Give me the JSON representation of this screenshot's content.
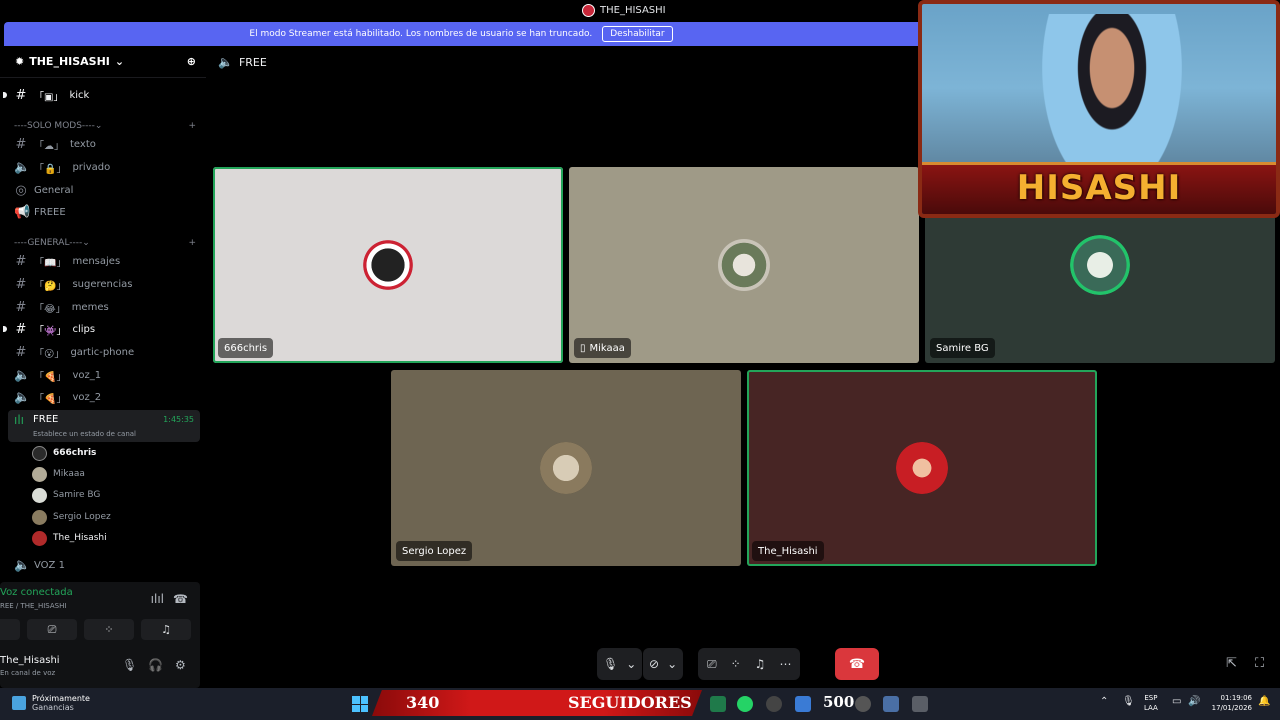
{
  "window": {
    "title": "THE_HISASHI"
  },
  "banner": {
    "message": "El modo Streamer está habilitado. Los nombres de usuario se han truncado.",
    "button": "Deshabilitar"
  },
  "server": {
    "name": "THE_HISASHI"
  },
  "channels": {
    "kick": "kick",
    "cat_mods": "----SOLO MODS----",
    "texto": "texto",
    "privado": "privado",
    "general": "General",
    "freee": "FREEE",
    "cat_general": "----GENERAL----",
    "mensajes": "mensajes",
    "sugerencias": "sugerencias",
    "memes": "memes",
    "clips": "clips",
    "gartic": "gartic-phone",
    "voz1": "voz_1",
    "voz2": "voz_2",
    "voz1_upper": "VOZ 1"
  },
  "active_voice": {
    "name": "FREE",
    "timer": "1:45:35",
    "status": "Establece un estado de canal"
  },
  "voice_users": [
    "666chris",
    "Mikaaa",
    "Samire BG",
    "Sergio Lopez",
    "The_Hisashi"
  ],
  "voice_panel": {
    "status": "Voz conectada",
    "location": "REE / THE_HISASHI",
    "user": "The_Hisashi",
    "user_status": "En canal de voz"
  },
  "stage": {
    "channel": "FREE",
    "tiles": [
      {
        "name": "666chris",
        "bg": "#dcd9d8",
        "speaking": true
      },
      {
        "name": "Mikaaa",
        "bg": "#9f9a87",
        "speaking": false,
        "mobile": true
      },
      {
        "name": "Samire BG",
        "bg": "#2e3a35",
        "speaking": false
      },
      {
        "name": "Sergio Lopez",
        "bg": "#6e6552",
        "speaking": false
      },
      {
        "name": "The_Hisashi",
        "bg": "#472524",
        "speaking": true
      }
    ]
  },
  "overlay": {
    "webcam_name": "HISASHI",
    "followers_count": "340",
    "followers_label": "SEGUIDORES",
    "goal": "500"
  },
  "taskbar": {
    "news_title": "Próximamente",
    "news_sub": "Ganancias",
    "lang1": "ESP",
    "lang2": "LAA",
    "time": "01:19:06",
    "date": "17/01/2026"
  }
}
